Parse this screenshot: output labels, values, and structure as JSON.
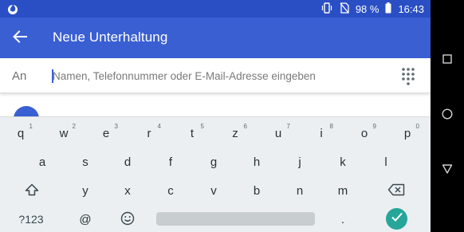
{
  "status_bar": {
    "battery": "98 %",
    "time": "16:43",
    "icons": [
      "fire-icon",
      "vibrate-icon",
      "no-sim-icon",
      "battery-icon"
    ]
  },
  "app_bar": {
    "title": "Neue Unterhaltung",
    "back_icon": "arrow-back-icon"
  },
  "recipient": {
    "label": "An",
    "placeholder": "Namen, Telefonnummer oder E-Mail-Adresse eingeben",
    "value": "",
    "dialpad_icon": "dialpad-icon"
  },
  "keyboard": {
    "row1": [
      {
        "key": "q",
        "hint": "1"
      },
      {
        "key": "w",
        "hint": "2"
      },
      {
        "key": "e",
        "hint": "3"
      },
      {
        "key": "r",
        "hint": "4"
      },
      {
        "key": "t",
        "hint": "5"
      },
      {
        "key": "z",
        "hint": "6"
      },
      {
        "key": "u",
        "hint": "7"
      },
      {
        "key": "i",
        "hint": "8"
      },
      {
        "key": "o",
        "hint": "9"
      },
      {
        "key": "p",
        "hint": "0"
      }
    ],
    "row2": [
      "a",
      "s",
      "d",
      "f",
      "g",
      "h",
      "j",
      "k",
      "l"
    ],
    "row3": [
      "y",
      "x",
      "c",
      "v",
      "b",
      "n",
      "m"
    ],
    "row4": {
      "symbols_label": "?123",
      "at_label": "@",
      "period_label": "."
    },
    "accent_color": "#26a69a"
  },
  "colors": {
    "app_bar": "#3a5fd3",
    "status_bar": "#2a4fc4"
  }
}
